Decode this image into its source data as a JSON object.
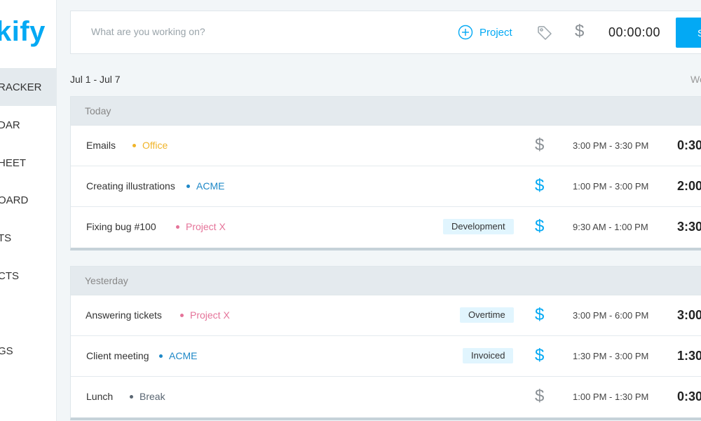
{
  "sidebar": {
    "logo": "kify",
    "items": [
      {
        "label": "RACKER",
        "active": true
      },
      {
        "label": "DAR",
        "active": false
      },
      {
        "label": "HEET",
        "active": false
      },
      {
        "label": "OARD",
        "active": false
      },
      {
        "label": "TS",
        "active": false
      },
      {
        "label": "CTS",
        "active": false
      },
      {
        "label": "GS",
        "active": false
      }
    ]
  },
  "timer": {
    "placeholder": "What are you working on?",
    "project_label": "Project",
    "time": "00:00:00",
    "start_label": "S",
    "billable_symbol": "$"
  },
  "week": {
    "range": "Jul 1 - Jul 7",
    "total_label": "We"
  },
  "colors": {
    "accent": "#03a9f4",
    "billable_on": "#03a9f4",
    "billable_off": "#8a9095",
    "office": "#f0b429",
    "acme": "#1e88c7",
    "project_x": "#e57399",
    "break": "#5a6672"
  },
  "days": [
    {
      "label": "Today",
      "entries": [
        {
          "description": "Emails",
          "project": "Office",
          "project_color": "#f0b429",
          "tag": "",
          "billable": false,
          "range": "3:00 PM - 3:30 PM",
          "duration": "0:30"
        },
        {
          "description": "Creating illustrations",
          "project": "ACME",
          "project_color": "#1e88c7",
          "tag": "",
          "billable": true,
          "range": "1:00 PM - 3:00 PM",
          "duration": "2:00"
        },
        {
          "description": "Fixing bug #100",
          "project": "Project X",
          "project_color": "#e57399",
          "tag": "Development",
          "billable": true,
          "range": "9:30 AM - 1:00 PM",
          "duration": "3:30"
        }
      ]
    },
    {
      "label": "Yesterday",
      "entries": [
        {
          "description": "Answering tickets",
          "project": "Project X",
          "project_color": "#e57399",
          "tag": "Overtime",
          "billable": true,
          "range": "3:00 PM - 6:00 PM",
          "duration": "3:00"
        },
        {
          "description": "Client meeting",
          "project": "ACME",
          "project_color": "#1e88c7",
          "tag": "Invoiced",
          "billable": true,
          "range": "1:30 PM - 3:00 PM",
          "duration": "1:30"
        },
        {
          "description": "Lunch",
          "project": "Break",
          "project_color": "#5a6672",
          "tag": "",
          "billable": false,
          "range": "1:00 PM - 1:30 PM",
          "duration": "0:30"
        }
      ]
    }
  ]
}
